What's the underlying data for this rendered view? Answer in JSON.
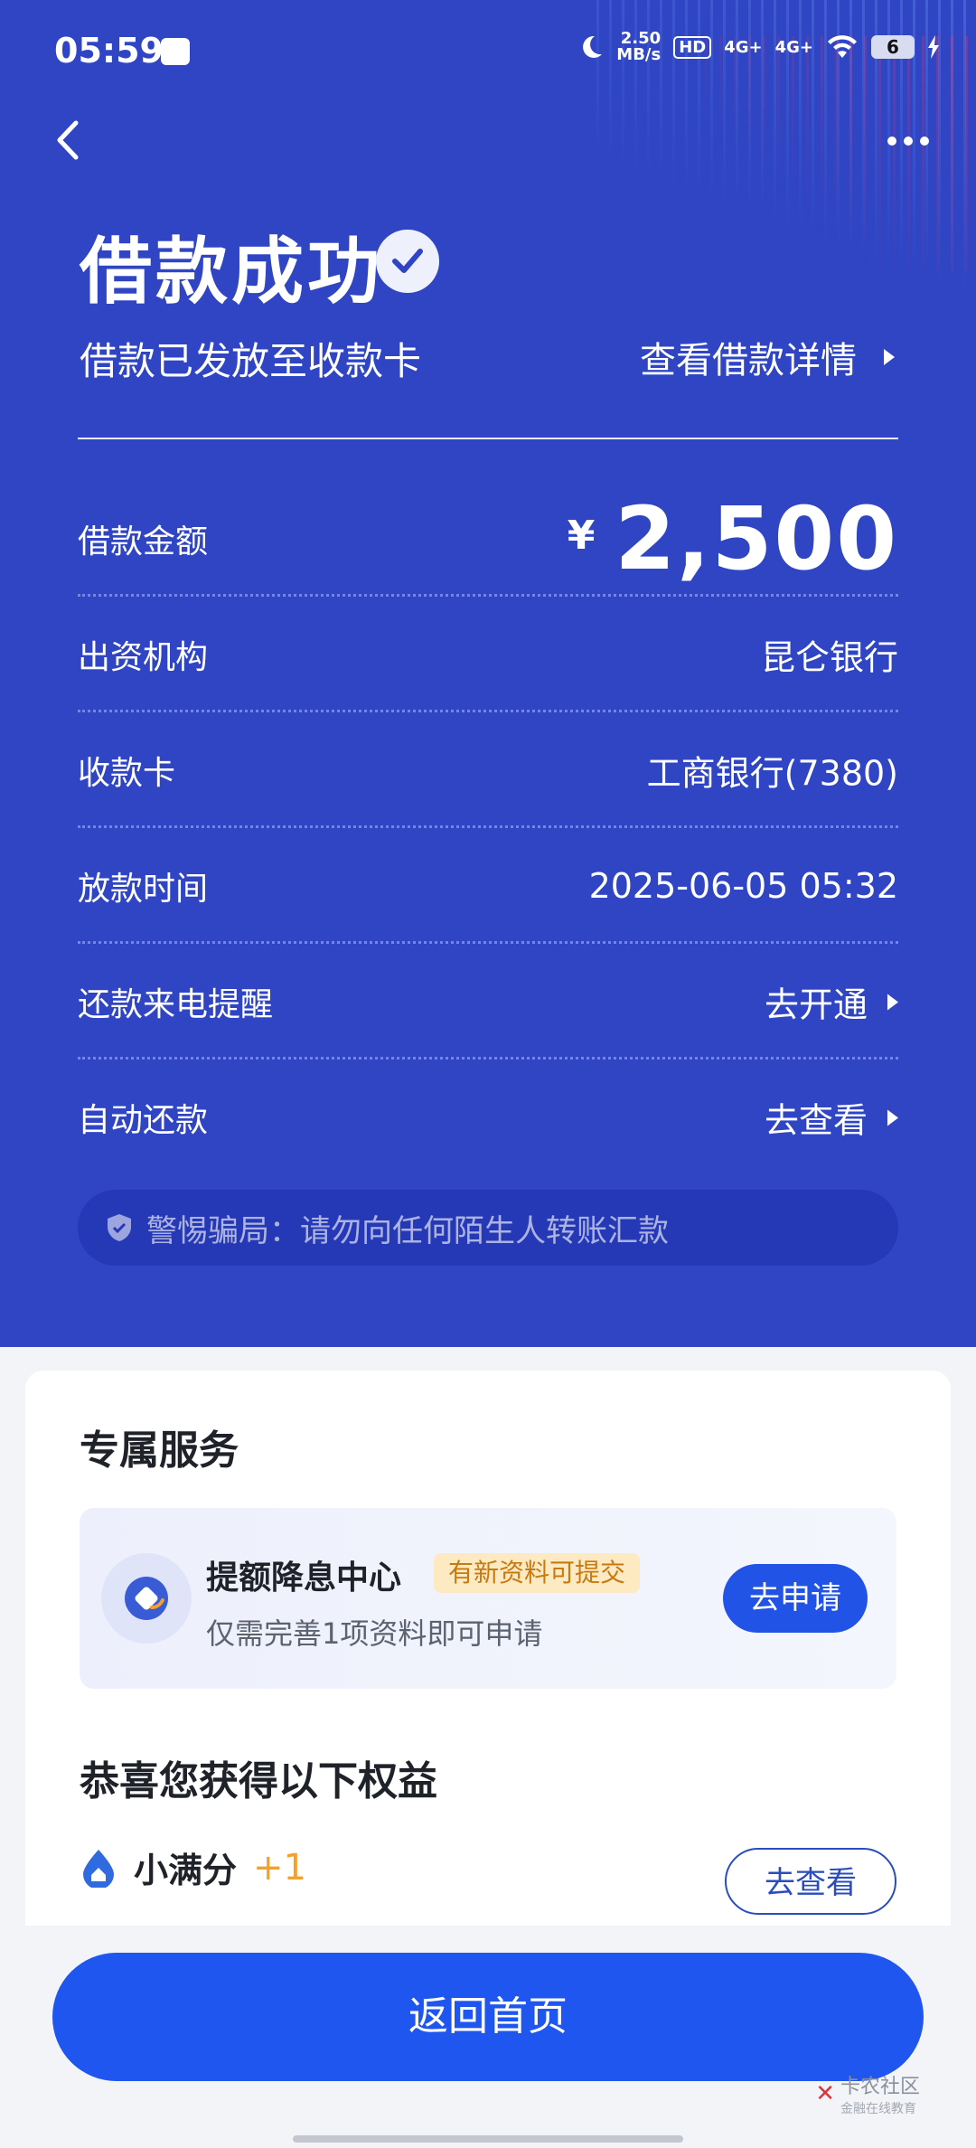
{
  "status_bar": {
    "time": "05:59",
    "speed_value": "2.50",
    "speed_unit": "MB/s",
    "hd": "HD",
    "sim1": "4G+",
    "sim2": "4G+",
    "battery": "6"
  },
  "header": {
    "title": "借款成功",
    "subtitle": "借款已发放至收款卡",
    "detail_link": "查看借款详情"
  },
  "details": {
    "amount_label": "借款金额",
    "amount_currency": "¥",
    "amount_value": "2,500",
    "rows": [
      {
        "label": "出资机构",
        "value": "昆仑银行"
      },
      {
        "label": "收款卡",
        "value": "工商银行(7380)"
      },
      {
        "label": "放款时间",
        "value": "2025-06-05 05:32"
      },
      {
        "label": "还款来电提醒",
        "value": "去开通"
      },
      {
        "label": "自动还款",
        "value": "去查看"
      }
    ]
  },
  "warning": "警惕骗局：请勿向任何陌生人转账汇款",
  "service": {
    "heading": "专属服务",
    "name": "提额降息中心",
    "tag": "有新资料可提交",
    "desc": "仅需完善1项资料即可申请",
    "button": "去申请"
  },
  "benefits": {
    "heading": "恭喜您获得以下权益",
    "item_name": "小满分",
    "item_plus": "+1",
    "button": "去查看"
  },
  "bottom": {
    "main_button": "返回首页",
    "watermark_text": "卡农社区",
    "watermark_sub": "金融在线教育"
  },
  "colors": {
    "header_bg": "#2f45c4",
    "primary_button": "#1f56f0",
    "tag_bg": "#fde9c2"
  }
}
